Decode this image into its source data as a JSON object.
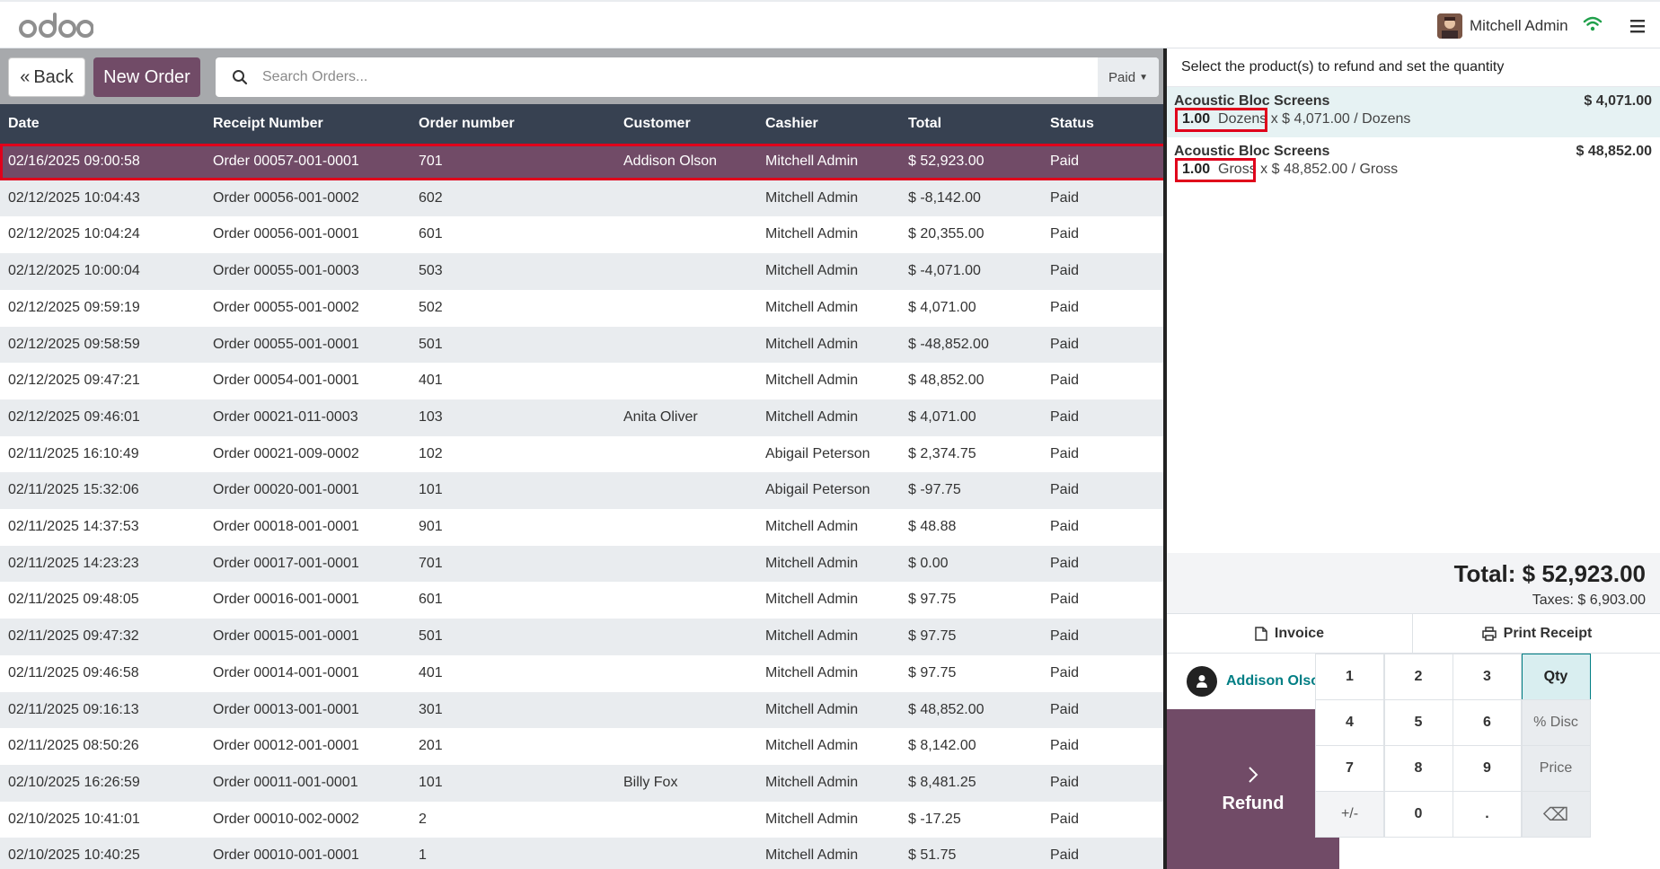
{
  "topbar": {
    "logo_text": "odoo",
    "user_name": "Mitchell Admin",
    "icons": [
      "wifi-icon",
      "hamburger-menu-icon"
    ]
  },
  "controls": {
    "back_label": "Back",
    "new_order_label": "New Order",
    "search_placeholder": "Search Orders...",
    "filter_label": "Paid"
  },
  "table": {
    "headers": [
      "Date",
      "Receipt Number",
      "Order number",
      "Customer",
      "Cashier",
      "Total",
      "Status"
    ],
    "rows": [
      {
        "date": "02/16/2025 09:00:58",
        "receipt": "Order 00057-001-0001",
        "order": "701",
        "customer": "Addison Olson",
        "cashier": "Mitchell Admin",
        "total": "$ 52,923.00",
        "status": "Paid"
      },
      {
        "date": "02/12/2025 10:04:43",
        "receipt": "Order 00056-001-0002",
        "order": "602",
        "customer": "",
        "cashier": "Mitchell Admin",
        "total": "$ -8,142.00",
        "status": "Paid"
      },
      {
        "date": "02/12/2025 10:04:24",
        "receipt": "Order 00056-001-0001",
        "order": "601",
        "customer": "",
        "cashier": "Mitchell Admin",
        "total": "$ 20,355.00",
        "status": "Paid"
      },
      {
        "date": "02/12/2025 10:00:04",
        "receipt": "Order 00055-001-0003",
        "order": "503",
        "customer": "",
        "cashier": "Mitchell Admin",
        "total": "$ -4,071.00",
        "status": "Paid"
      },
      {
        "date": "02/12/2025 09:59:19",
        "receipt": "Order 00055-001-0002",
        "order": "502",
        "customer": "",
        "cashier": "Mitchell Admin",
        "total": "$ 4,071.00",
        "status": "Paid"
      },
      {
        "date": "02/12/2025 09:58:59",
        "receipt": "Order 00055-001-0001",
        "order": "501",
        "customer": "",
        "cashier": "Mitchell Admin",
        "total": "$ -48,852.00",
        "status": "Paid"
      },
      {
        "date": "02/12/2025 09:47:21",
        "receipt": "Order 00054-001-0001",
        "order": "401",
        "customer": "",
        "cashier": "Mitchell Admin",
        "total": "$ 48,852.00",
        "status": "Paid"
      },
      {
        "date": "02/12/2025 09:46:01",
        "receipt": "Order 00021-011-0003",
        "order": "103",
        "customer": "Anita Oliver",
        "cashier": "Mitchell Admin",
        "total": "$ 4,071.00",
        "status": "Paid"
      },
      {
        "date": "02/11/2025 16:10:49",
        "receipt": "Order 00021-009-0002",
        "order": "102",
        "customer": "",
        "cashier": "Abigail Peterson",
        "total": "$ 2,374.75",
        "status": "Paid"
      },
      {
        "date": "02/11/2025 15:32:06",
        "receipt": "Order 00020-001-0001",
        "order": "101",
        "customer": "",
        "cashier": "Abigail Peterson",
        "total": "$ -97.75",
        "status": "Paid"
      },
      {
        "date": "02/11/2025 14:37:53",
        "receipt": "Order 00018-001-0001",
        "order": "901",
        "customer": "",
        "cashier": "Mitchell Admin",
        "total": "$ 48.88",
        "status": "Paid"
      },
      {
        "date": "02/11/2025 14:23:23",
        "receipt": "Order 00017-001-0001",
        "order": "701",
        "customer": "",
        "cashier": "Mitchell Admin",
        "total": "$ 0.00",
        "status": "Paid"
      },
      {
        "date": "02/11/2025 09:48:05",
        "receipt": "Order 00016-001-0001",
        "order": "601",
        "customer": "",
        "cashier": "Mitchell Admin",
        "total": "$ 97.75",
        "status": "Paid"
      },
      {
        "date": "02/11/2025 09:47:32",
        "receipt": "Order 00015-001-0001",
        "order": "501",
        "customer": "",
        "cashier": "Mitchell Admin",
        "total": "$ 97.75",
        "status": "Paid"
      },
      {
        "date": "02/11/2025 09:46:58",
        "receipt": "Order 00014-001-0001",
        "order": "401",
        "customer": "",
        "cashier": "Mitchell Admin",
        "total": "$ 97.75",
        "status": "Paid"
      },
      {
        "date": "02/11/2025 09:16:13",
        "receipt": "Order 00013-001-0001",
        "order": "301",
        "customer": "",
        "cashier": "Mitchell Admin",
        "total": "$ 48,852.00",
        "status": "Paid"
      },
      {
        "date": "02/11/2025 08:50:26",
        "receipt": "Order 00012-001-0001",
        "order": "201",
        "customer": "",
        "cashier": "Mitchell Admin",
        "total": "$ 8,142.00",
        "status": "Paid"
      },
      {
        "date": "02/10/2025 16:26:59",
        "receipt": "Order 00011-001-0001",
        "order": "101",
        "customer": "Billy Fox",
        "cashier": "Mitchell Admin",
        "total": "$ 8,481.25",
        "status": "Paid"
      },
      {
        "date": "02/10/2025 10:41:01",
        "receipt": "Order 00010-002-0002",
        "order": "2",
        "customer": "",
        "cashier": "Mitchell Admin",
        "total": "$ -17.25",
        "status": "Paid"
      },
      {
        "date": "02/10/2025 10:40:25",
        "receipt": "Order 00010-001-0001",
        "order": "1",
        "customer": "",
        "cashier": "Mitchell Admin",
        "total": "$ 51.75",
        "status": "Paid"
      }
    ]
  },
  "refund_panel": {
    "instruction": "Select the product(s) to refund and set the quantity",
    "lines": [
      {
        "name": "Acoustic Bloc Screens",
        "price": "$ 4,071.00",
        "qty": "1.00",
        "unit": "Dozens",
        "detail": "x $ 4,071.00 / Dozens"
      },
      {
        "name": "Acoustic Bloc Screens",
        "price": "$ 48,852.00",
        "qty": "1.00",
        "unit": "Gross",
        "detail": "x $ 48,852.00 / Gross"
      }
    ],
    "total": "Total: $ 52,923.00",
    "taxes": "Taxes: $ 6,903.00",
    "invoice_label": "Invoice",
    "print_label": "Print Receipt",
    "customer_name": "Addison Olson",
    "refund_label": "Refund",
    "keys": [
      "1",
      "2",
      "3",
      "Qty",
      "4",
      "5",
      "6",
      "% Disc",
      "7",
      "8",
      "9",
      "Price",
      "+/-",
      "0",
      ".",
      "⌫"
    ]
  },
  "colors": {
    "brand": "#714b67",
    "header_bg": "#374151",
    "accent_teal": "#017e84",
    "highlight": "#e0001b"
  }
}
